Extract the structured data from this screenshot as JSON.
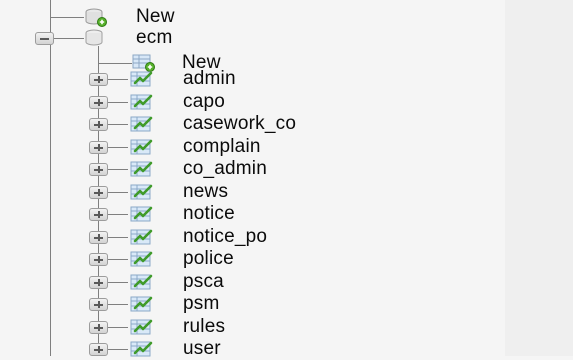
{
  "tree": {
    "root_new": {
      "label": "New",
      "icon": "new-database-icon"
    },
    "database": {
      "label": "ecm",
      "icon": "database-icon",
      "expanded": true
    },
    "db_new": {
      "label": "New",
      "icon": "new-table-icon"
    },
    "tables": [
      {
        "label": "admin",
        "icon": "table-icon"
      },
      {
        "label": "capo",
        "icon": "table-icon"
      },
      {
        "label": "casework_co",
        "icon": "table-icon"
      },
      {
        "label": "complain",
        "icon": "table-icon"
      },
      {
        "label": "co_admin",
        "icon": "table-icon"
      },
      {
        "label": "news",
        "icon": "table-icon"
      },
      {
        "label": "notice",
        "icon": "table-icon"
      },
      {
        "label": "notice_po",
        "icon": "table-icon"
      },
      {
        "label": "police",
        "icon": "table-icon"
      },
      {
        "label": "psca",
        "icon": "table-icon"
      },
      {
        "label": "psm",
        "icon": "table-icon"
      },
      {
        "label": "rules",
        "icon": "table-icon"
      },
      {
        "label": "user",
        "icon": "table-icon"
      }
    ]
  },
  "colors": {
    "background": "#f5f5f5",
    "tree_line": "#7f7f7f",
    "text": "#0b0b0b"
  }
}
